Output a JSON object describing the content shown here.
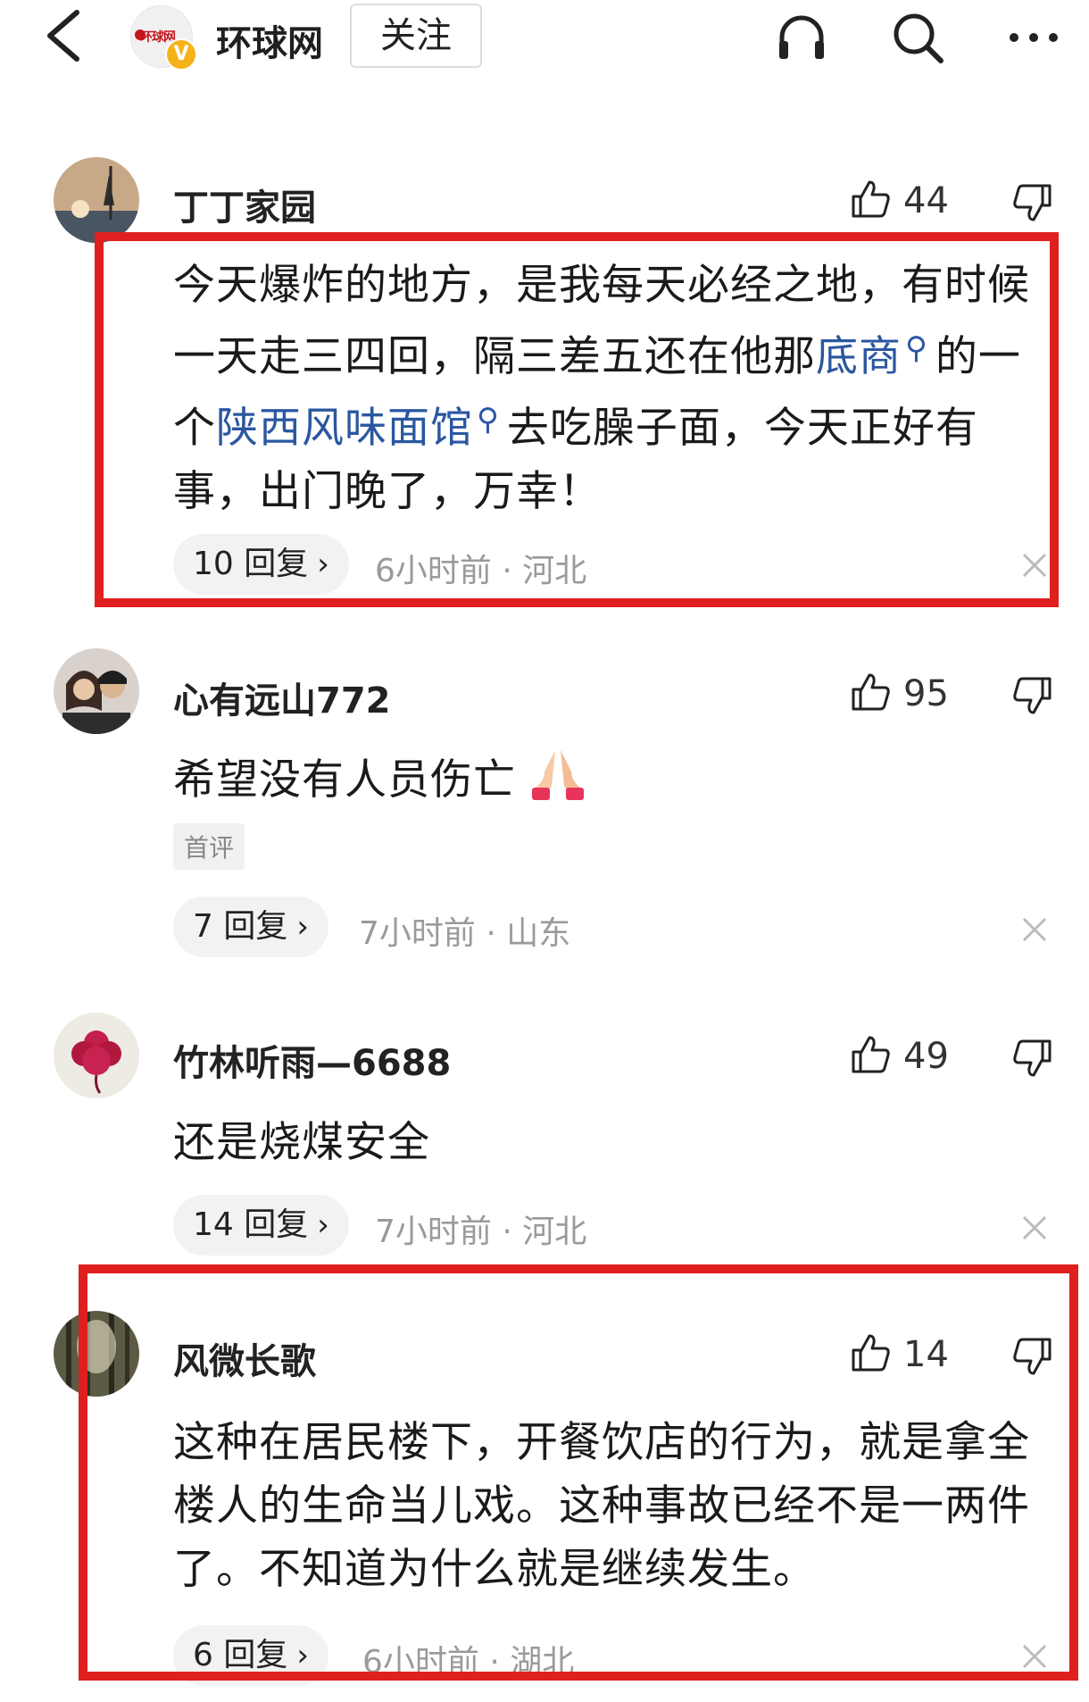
{
  "header": {
    "publisher_name": "环球网",
    "logo_text": "环球网",
    "verified_badge": "V",
    "follow_label": "关注",
    "icons": [
      "back-icon",
      "headphones-icon",
      "search-icon",
      "more-icon"
    ]
  },
  "comments": [
    {
      "user": "丁丁家园",
      "likes": "44",
      "text_parts": [
        "今天爆炸的地方，是我每天必经之地，有时候一天走三四回，隔三差五还在他那",
        "底商",
        "的一个",
        "陕西风味面馆",
        "去吃臊子面，今天正好有事，出门晚了，万幸！"
      ],
      "replies": "10 回复",
      "meta": "6小时前 · 河北",
      "highlighted": true
    },
    {
      "user": "心有远山772",
      "likes": "95",
      "text": "希望没有人员伤亡",
      "tag": "首评",
      "replies": "7 回复",
      "meta": "7小时前 · 山东",
      "highlighted": false
    },
    {
      "user": "竹林听雨—6688",
      "likes": "49",
      "text": "还是烧煤安全",
      "replies": "14 回复",
      "meta": "7小时前 · 河北",
      "highlighted": false
    },
    {
      "user": "风微长歌",
      "likes": "14",
      "text": "这种在居民楼下，开餐饮店的行为，就是拿全楼人的生命当儿戏。这种事故已经不是一两件了。不知道为什么就是继续发生。",
      "replies": "6 回复",
      "meta": "6小时前 · 湖北",
      "highlighted": true
    }
  ],
  "colors": {
    "highlight_border": "#e01f1f",
    "link": "#2b57a0",
    "meta_text": "#9a9a9a"
  }
}
